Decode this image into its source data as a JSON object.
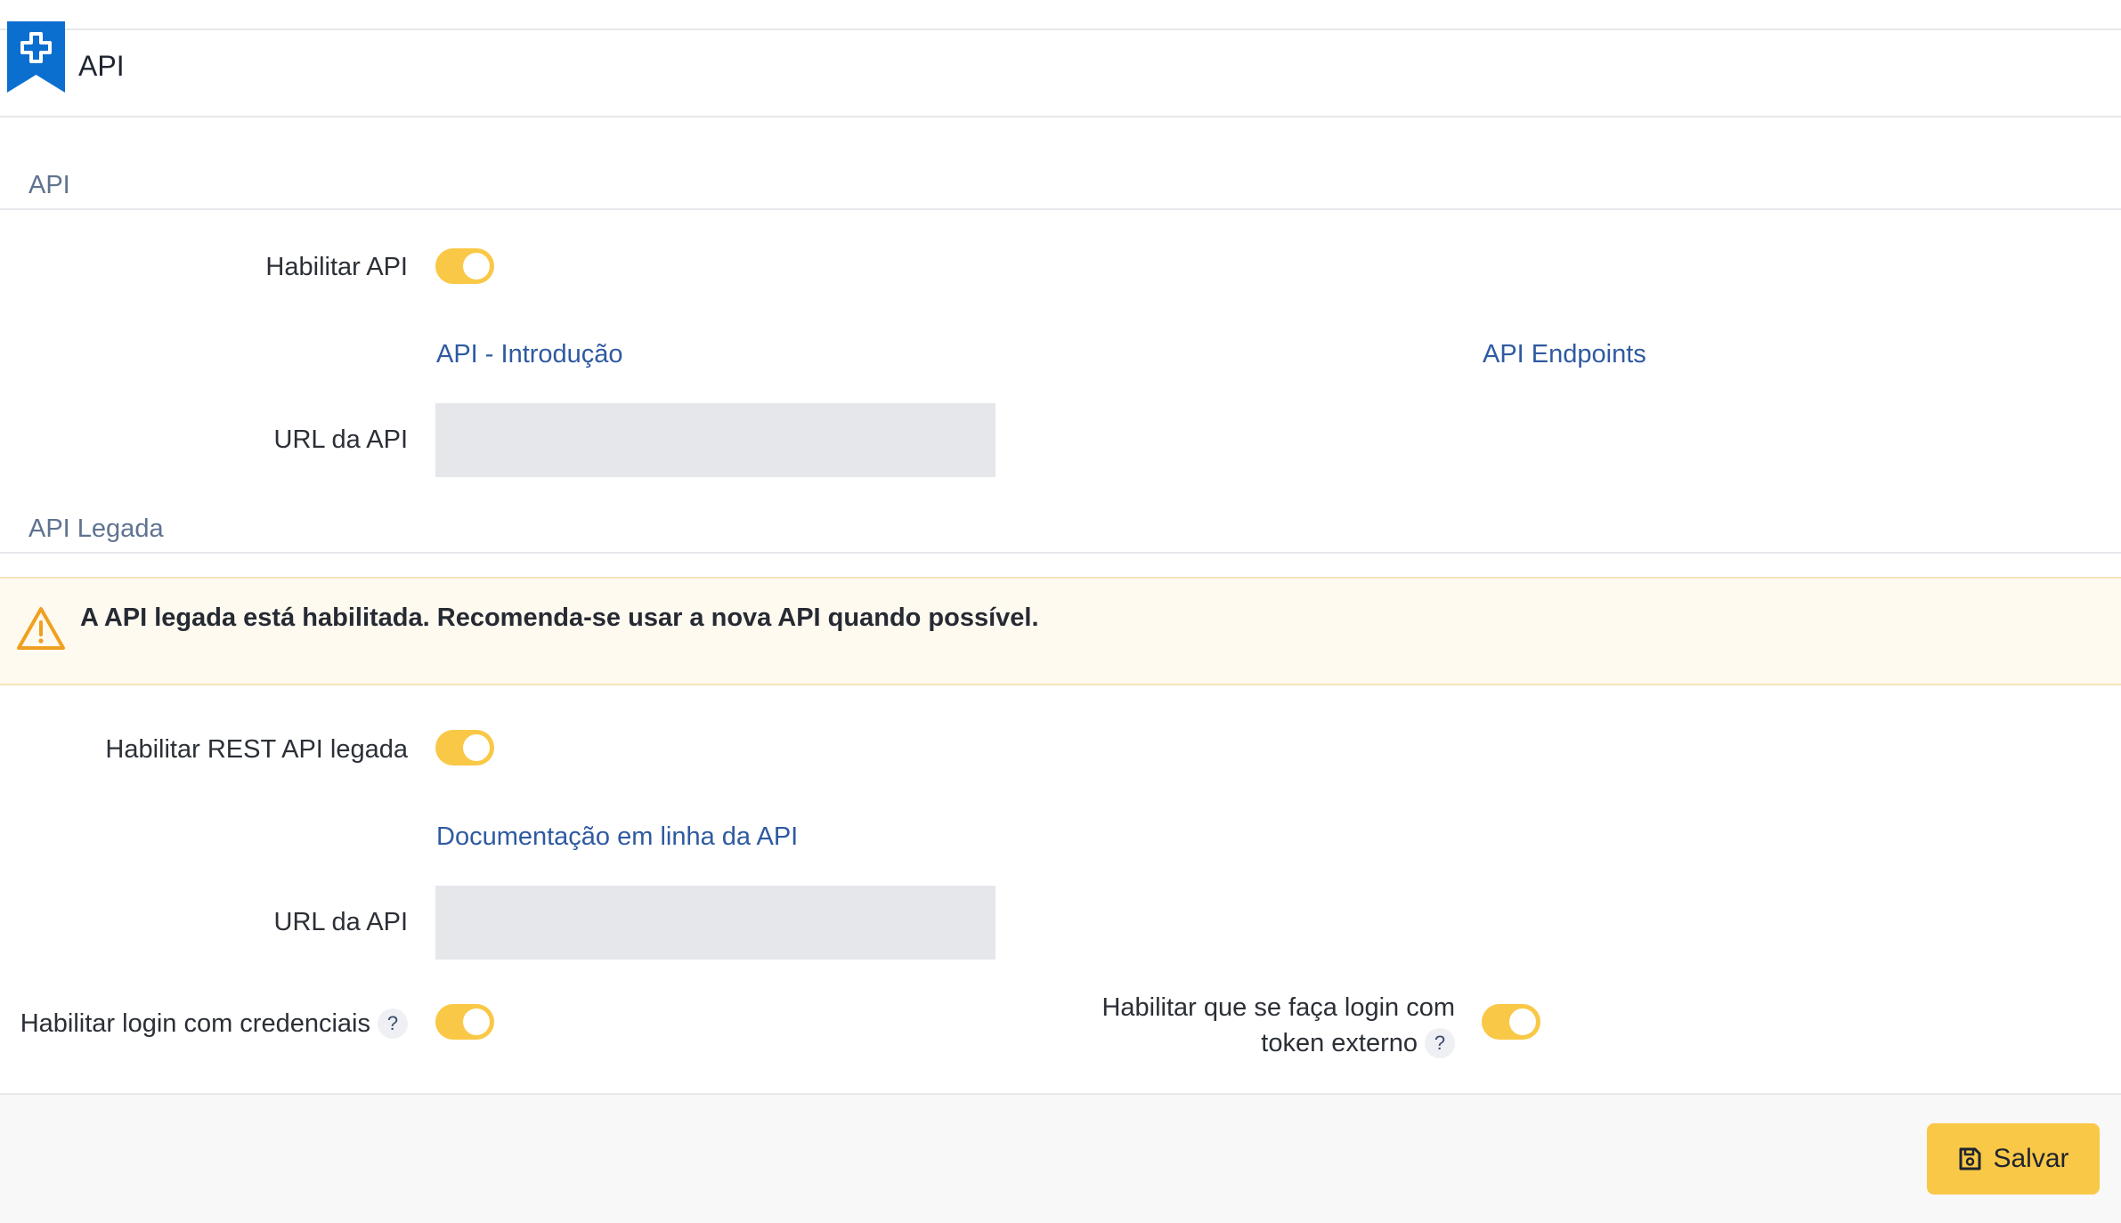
{
  "header": {
    "title": "API"
  },
  "sections": {
    "api": {
      "title": "API",
      "enable_label": "Habilitar API",
      "enable_value": true,
      "link_intro": "API - Introdução",
      "link_endpoints": "API Endpoints",
      "url_label": "URL da API",
      "url_value": ""
    },
    "legacy": {
      "title": "API Legada",
      "warning_text": "A API legada está habilitada. Recomenda-se usar a nova API quando possível.",
      "enable_rest_label": "Habilitar REST API legada",
      "enable_rest_value": true,
      "doc_link": "Documentação em linha da API",
      "url_label": "URL da API",
      "url_value": "",
      "login_credentials_label": "Habilitar login com credenciais",
      "login_credentials_value": true,
      "login_token_label_line1": "Habilitar que se faça login com",
      "login_token_label_line2": "token externo",
      "login_token_value": true,
      "help_glyph": "?"
    }
  },
  "footer": {
    "save_label": "Salvar"
  },
  "colors": {
    "accent": "#f9c846",
    "link": "#2f5aa0",
    "brand": "#0b6fd0"
  },
  "icons": {
    "logo": "plugin-icon",
    "warning": "warning-icon",
    "save": "save-icon"
  }
}
